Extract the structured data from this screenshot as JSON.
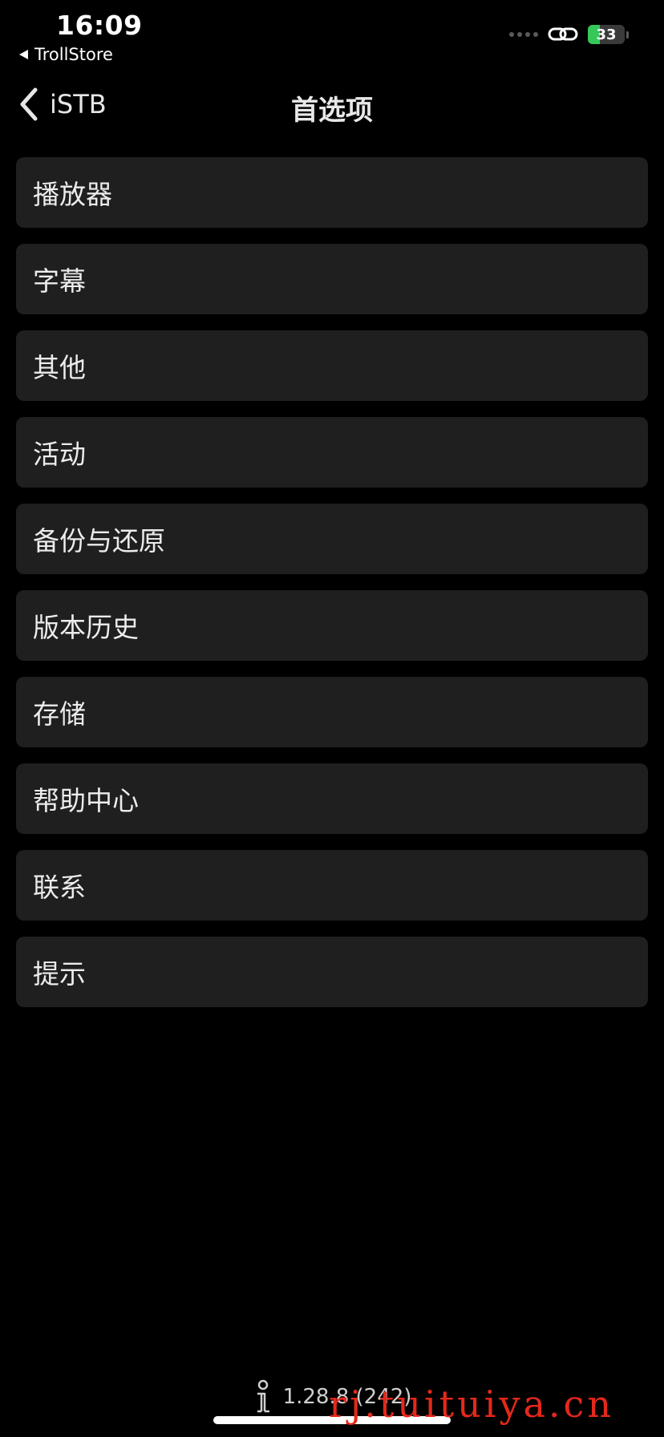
{
  "status_bar": {
    "time": "16:09",
    "back_app": "TrollStore",
    "battery_level": "33",
    "battery_fraction": 0.33
  },
  "nav": {
    "back_label": "iSTB",
    "title": "首选项"
  },
  "menu": {
    "items": [
      {
        "label": "播放器"
      },
      {
        "label": "字幕"
      },
      {
        "label": "其他"
      },
      {
        "label": "活动"
      },
      {
        "label": "备份与还原"
      },
      {
        "label": "版本历史"
      },
      {
        "label": "存储"
      },
      {
        "label": "帮助中心"
      },
      {
        "label": "联系"
      },
      {
        "label": "提示"
      }
    ]
  },
  "footer": {
    "version": "1.28.8 (242)"
  },
  "watermark": "rj.tuituiya.cn",
  "colors": {
    "background": "#000000",
    "cell_background": "#1f1f1f",
    "battery_green": "#35c759",
    "watermark_red": "#e4281b"
  },
  "icons": {
    "back": "chevron-left-icon",
    "link": "link-icon",
    "footer": "info-person-icon"
  }
}
